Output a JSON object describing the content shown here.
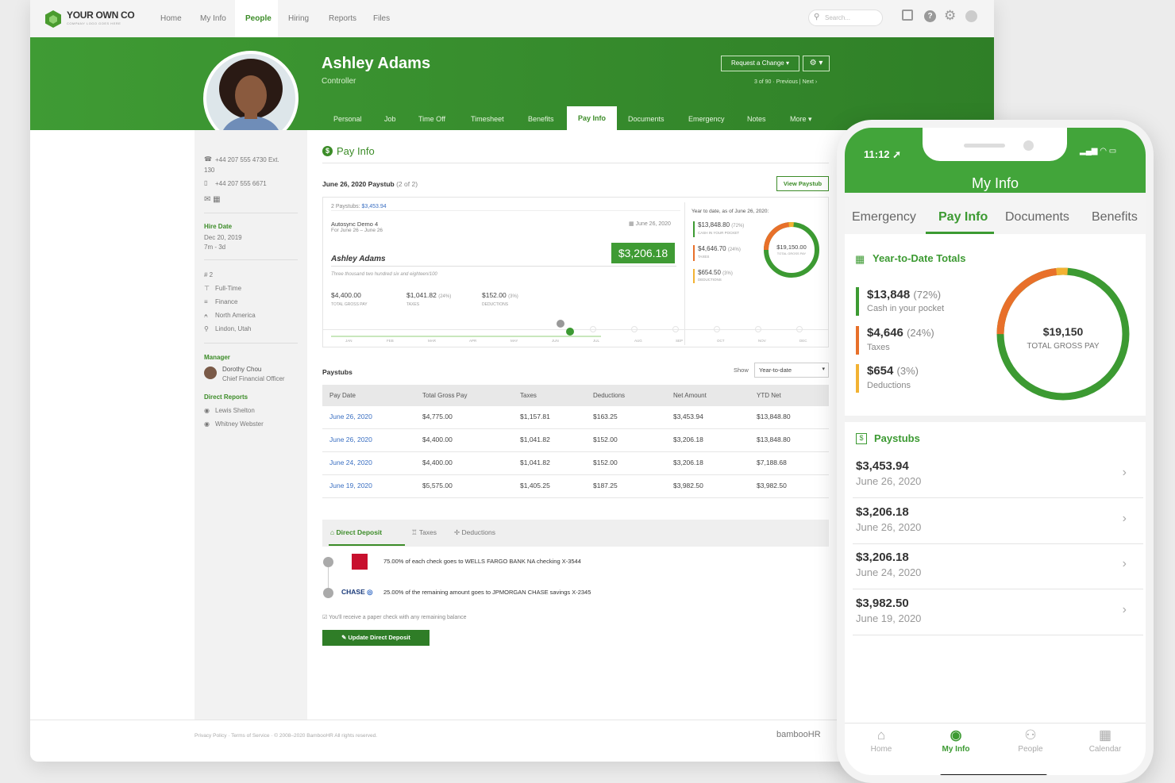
{
  "brand": {
    "logo_text": "YOUR OWN CO",
    "logo_sub": "COMPANY LOGO GOES HERE"
  },
  "nav": {
    "items": [
      "Home",
      "My Info",
      "People",
      "Hiring",
      "Reports",
      "Files"
    ],
    "active": "People"
  },
  "search": {
    "placeholder": "Search..."
  },
  "employee": {
    "name": "Ashley Adams",
    "title": "Controller",
    "request_change": "Request a Change ▾",
    "pager": "3 of 90 · Previous | Next ›"
  },
  "tabs": [
    "Personal",
    "Job",
    "Time Off",
    "Timesheet",
    "Benefits",
    "Pay Info",
    "Documents",
    "Emergency",
    "Notes",
    "More ▾"
  ],
  "sidebar": {
    "phone1": "+44 207 555 4730  Ext.",
    "phone1_ext": "130",
    "phone2": "+44 207 555 6671",
    "hire_date_label": "Hire Date",
    "hire_date": "Dec 20, 2019",
    "hire_tenure": "7m - 3d",
    "emp_number": "# 2",
    "emp_type": "Full-Time",
    "department": "Finance",
    "region": "North America",
    "location": "Lindon, Utah",
    "manager_label": "Manager",
    "manager_name": "Dorothy Chou",
    "manager_title": "Chief Financial Officer",
    "direct_reports_label": "Direct Reports",
    "report1": "Lewis Shelton",
    "report2": "Whitney Webster"
  },
  "payinfo": {
    "heading": "Pay Info",
    "paystub_title": "June 26, 2020 Paystub",
    "paystub_count": "(2 of 2)",
    "view_paystub": "View Paystub",
    "paystubs_count_label": "2 Paystubs:",
    "paystubs_count_value": "$3,453.94",
    "company": "Autosync Demo 4",
    "period": "For June 26 – June 26",
    "check_date": "June 26, 2020",
    "payee": "Ashley Adams",
    "amount_words": "Three thousand two hundred six and eighteen/100",
    "net_amount": "$3,206.18",
    "gross": "$4,400.00",
    "gross_label": "TOTAL GROSS PAY",
    "taxes": "$1,041.82",
    "taxes_pct": "(24%)",
    "taxes_label": "TAXES",
    "deductions": "$152.00",
    "deductions_pct": "(3%)",
    "deductions_label": "DEDUCTIONS",
    "months": [
      "JAN",
      "FEB",
      "MAR",
      "APR",
      "MAY",
      "JUN",
      "JUL",
      "AUG",
      "SEP",
      "OCT",
      "NOV",
      "DEC"
    ],
    "ytd_title": "Year to date, as of June 26, 2020:",
    "ytd_cash": "$13,848.80",
    "ytd_cash_pct": "(72%)",
    "ytd_cash_label": "CASH IN YOUR POCKET",
    "ytd_taxes": "$4,646.70",
    "ytd_taxes_pct": "(24%)",
    "ytd_taxes_label": "TAXES",
    "ytd_ded": "$654.50",
    "ytd_ded_pct": "(3%)",
    "ytd_ded_label": "DEDUCTIONS",
    "ytd_total": "$19,150.00",
    "ytd_total_label": "TOTAL GROSS PAY"
  },
  "paystubs": {
    "label": "Paystubs",
    "show_label": "Show",
    "filter": "Year-to-date",
    "columns": [
      "Pay Date",
      "Total Gross Pay",
      "Taxes",
      "Deductions",
      "Net Amount",
      "YTD Net"
    ],
    "rows": [
      [
        "June 26, 2020",
        "$4,775.00",
        "$1,157.81",
        "$163.25",
        "$3,453.94",
        "$13,848.80"
      ],
      [
        "June 26, 2020",
        "$4,400.00",
        "$1,041.82",
        "$152.00",
        "$3,206.18",
        "$13,848.80"
      ],
      [
        "June 24, 2020",
        "$4,400.00",
        "$1,041.82",
        "$152.00",
        "$3,206.18",
        "$7,188.68"
      ],
      [
        "June 19, 2020",
        "$5,575.00",
        "$1,405.25",
        "$187.25",
        "$3,982.50",
        "$3,982.50"
      ]
    ]
  },
  "deposit": {
    "tabs": [
      "Direct Deposit",
      "Taxes",
      "Deductions"
    ],
    "line1": "75.00% of each check goes to WELLS FARGO BANK NA checking X-3544",
    "chase_logo": "CHASE",
    "line2": "25.00% of the remaining amount goes to JPMORGAN CHASE savings X-2345",
    "note": "You'll receive a paper check with any remaining balance",
    "button": "Update Direct Deposit"
  },
  "footer": {
    "text": "Privacy Policy · Terms of Service · © 2008–2020 BambooHR All rights reserved.",
    "brand": "bambooHR"
  },
  "phone": {
    "time": "11:12",
    "title": "My Info",
    "tabs": [
      "Emergency",
      "Pay Info",
      "Documents",
      "Benefits"
    ],
    "ytd_heading": "Year-to-Date Totals",
    "cash": "$13,848",
    "cash_pct": "(72%)",
    "cash_label": "Cash in your pocket",
    "taxes": "$4,646",
    "taxes_pct": "(24%)",
    "taxes_label": "Taxes",
    "ded": "$654",
    "ded_pct": "(3%)",
    "ded_label": "Deductions",
    "total": "$19,150",
    "total_label": "TOTAL GROSS PAY",
    "paystubs_heading": "Paystubs",
    "stubs": [
      {
        "amount": "$3,453.94",
        "date": "June 26, 2020"
      },
      {
        "amount": "$3,206.18",
        "date": "June 26, 2020"
      },
      {
        "amount": "$3,206.18",
        "date": "June 24, 2020"
      },
      {
        "amount": "$3,982.50",
        "date": "June 19, 2020"
      }
    ],
    "nav": [
      "Home",
      "My Info",
      "People",
      "Calendar"
    ]
  },
  "colors": {
    "brand_green": "#42a53a",
    "taxes_orange": "#e8702a",
    "deductions_yellow": "#f2b233",
    "link_blue": "#3a6fc2"
  },
  "icons": [
    "logo-hexagon-icon",
    "search-icon",
    "inbox-icon",
    "help-icon",
    "gear-icon",
    "avatar-icon",
    "dollar-icon",
    "chevron-right-icon",
    "home-icon",
    "people-icon",
    "calendar-icon",
    "calendar-ytd-icon",
    "bank-icon",
    "pencil-icon"
  ]
}
